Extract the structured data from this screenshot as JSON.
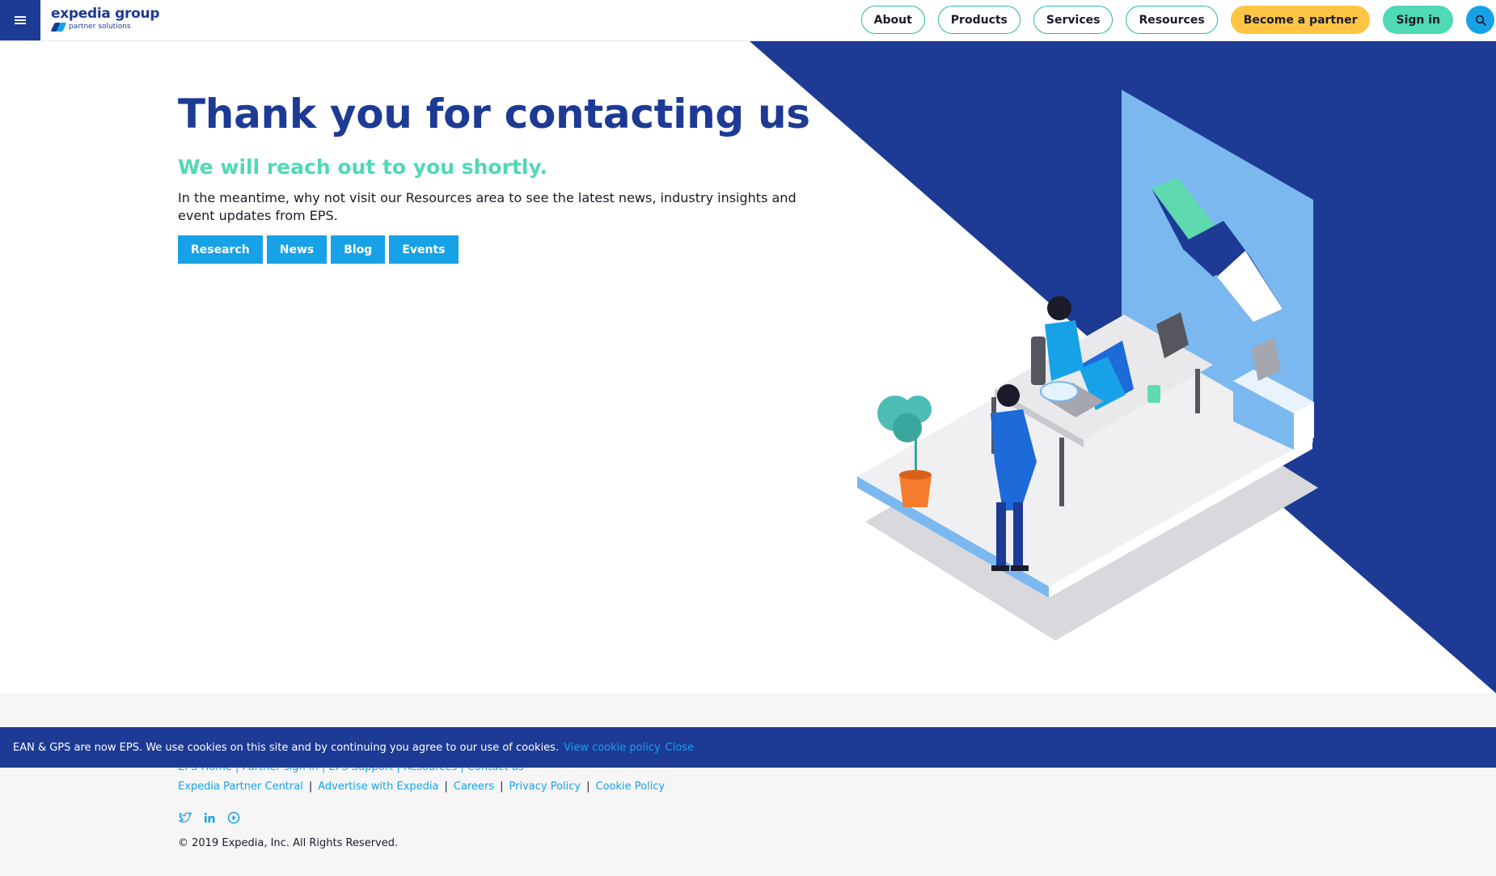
{
  "header": {
    "logo_brand": "expedia group",
    "logo_sub": "partner solutions",
    "nav": {
      "about": "About",
      "products": "Products",
      "services": "Services",
      "resources": "Resources",
      "become_partner": "Become a partner",
      "sign_in": "Sign in"
    },
    "icons": {
      "menu": "hamburger-menu-icon",
      "search": "search-icon"
    }
  },
  "hero": {
    "title": "Thank you for contacting us",
    "subtitle": "We will reach out to you shortly.",
    "description": "In the meantime, why not visit our Resources area to see the latest news, industry insights and event updates from EPS.",
    "buttons": {
      "research": "Research",
      "news": "News",
      "blog": "Blog",
      "events": "Events"
    }
  },
  "cookie_banner": {
    "text": "EAN & GPS are now EPS. We use cookies on this site and by continuing you agree to our use of cookies.",
    "policy_link": "View cookie policy",
    "close_link": "Close"
  },
  "footer": {
    "obscured_links": "EPS Home | Partner sign in | EPS Support | Resources | Contact us",
    "links": {
      "partner_central": "Expedia Partner Central",
      "advertise": "Advertise with Expedia",
      "careers": "Careers",
      "privacy": "Privacy Policy",
      "cookie_policy": "Cookie Policy"
    },
    "separator": "|",
    "copyright": "© 2019 Expedia, Inc. All Rights Reserved.",
    "social_icons": [
      "twitter-icon",
      "linkedin-icon",
      "play-icon"
    ]
  },
  "colors": {
    "brand_blue": "#1d3a94",
    "accent_teal": "#50d9b5",
    "link_blue": "#17a2e8",
    "yellow": "#fdc543",
    "light_blue": "#7bb8f0"
  }
}
